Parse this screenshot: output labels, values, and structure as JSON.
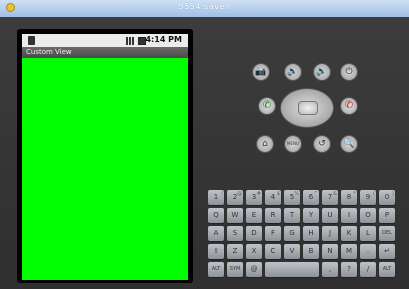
{
  "window": {
    "title": "5554:saven"
  },
  "status_bar": {
    "time": "4:14 PM"
  },
  "app": {
    "title": "Custom View",
    "background_color": "#00ff00"
  },
  "controls": {
    "camera_label": "📷",
    "vol_down_label": "🔉",
    "vol_up_label": "🔊",
    "power_label": "⏻",
    "call_label": "✆",
    "end_label": "✆",
    "home_label": "⌂",
    "menu_label": "MENU",
    "back_label": "↺",
    "search_label": "🔍"
  },
  "keyboard": {
    "row1": [
      "1",
      "2",
      "3",
      "4",
      "5",
      "6",
      "7",
      "8",
      "9",
      "0"
    ],
    "row1_alt": [
      "!",
      "@",
      "#",
      "$",
      "%",
      "^",
      "&",
      "*",
      "(",
      ")"
    ],
    "row2": [
      "Q",
      "W",
      "E",
      "R",
      "T",
      "Y",
      "U",
      "I",
      "O",
      "P"
    ],
    "row3": [
      "A",
      "S",
      "D",
      "F",
      "G",
      "H",
      "J",
      "K",
      "L",
      "DEL"
    ],
    "row4": [
      "⇧",
      "Z",
      "X",
      "C",
      "V",
      "B",
      "N",
      "M",
      ".",
      "↵"
    ],
    "row5": [
      "ALT",
      "SYM",
      "@",
      "",
      ",",
      "?",
      "/",
      "ALT"
    ]
  }
}
